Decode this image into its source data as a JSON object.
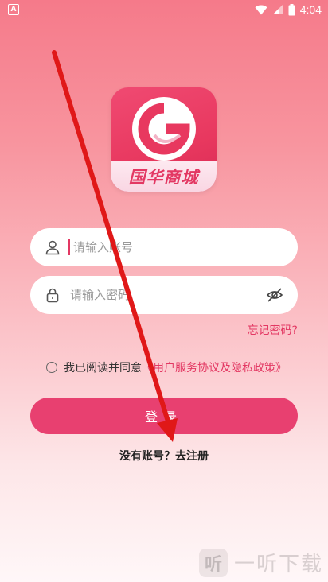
{
  "status_bar": {
    "badge": "A",
    "time": "4:04"
  },
  "app": {
    "logo_text": "国华商城",
    "colors": {
      "primary": "#e84070",
      "link": "#e33863"
    }
  },
  "form": {
    "account_placeholder": "请输入账号",
    "password_placeholder": "请输入密码",
    "forgot_label": "忘记密码?",
    "agree_prefix": "我已阅读并同意",
    "agree_link": "《用户服务协议及隐私政策》",
    "login_label": "登录",
    "register_label": "没有账号？去注册"
  },
  "watermark": {
    "icon_text": "听",
    "text": "一听下载"
  },
  "icons": [
    "wifi-icon",
    "battery-icon",
    "user-icon",
    "lock-icon",
    "eye-off-icon"
  ]
}
